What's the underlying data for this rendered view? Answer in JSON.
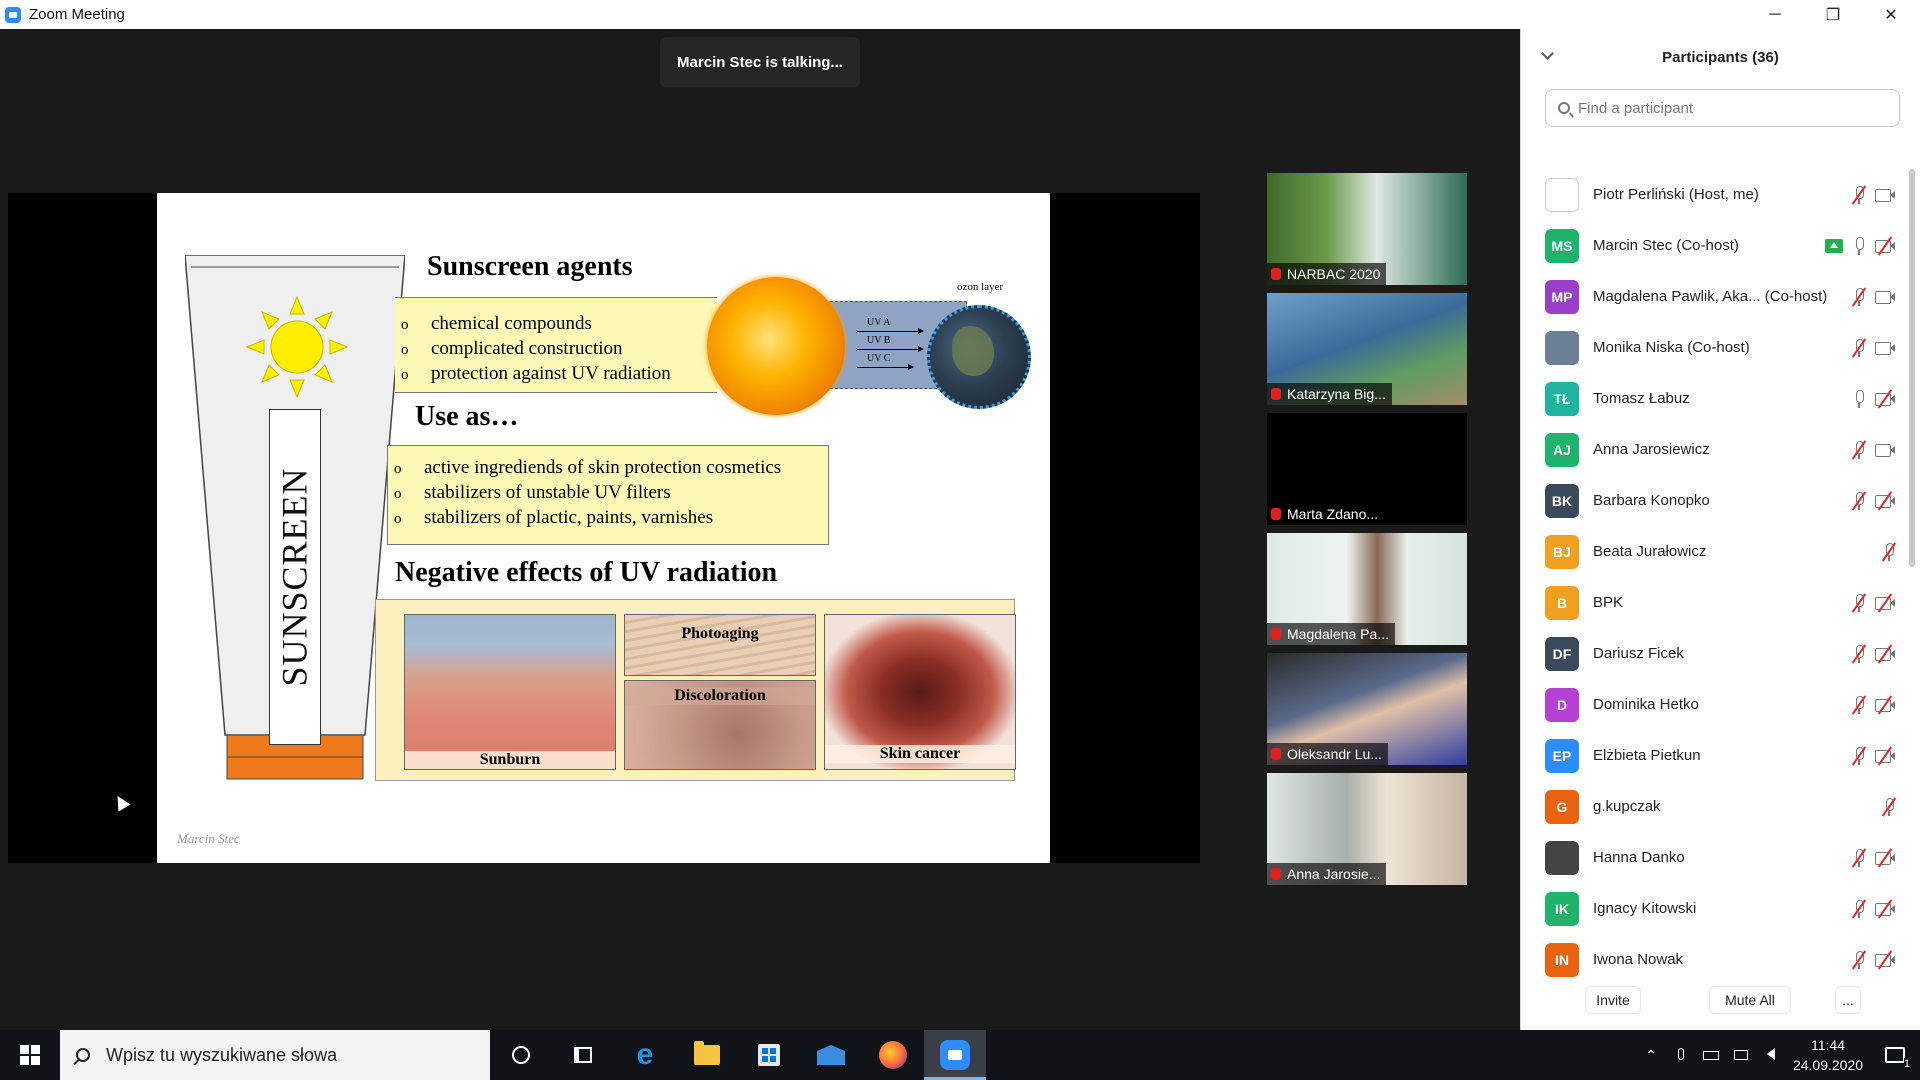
{
  "window": {
    "title": "Zoom Meeting",
    "minimize_glyph": "─",
    "restore_glyph": "❐",
    "close_glyph": "✕"
  },
  "meeting": {
    "talking_indicator": "Marcin Stec is talking..."
  },
  "slide": {
    "tube_label": "SUNSCREEN",
    "heading_agents": "Sunscreen agents",
    "agents_items": [
      "chemical compounds",
      "complicated construction",
      "protection against UV radiation"
    ],
    "ozone_label": "ozon layer",
    "uv_labels": [
      "UV A",
      "UV B",
      "UV C"
    ],
    "heading_use": "Use as…",
    "use_items": [
      "active ingrediends of skin protection cosmetics",
      "stabilizers of unstable UV filters",
      "stabilizers of plactic, paints, varnishes"
    ],
    "heading_negative": "Negative effects of UV radiation",
    "images": {
      "sunburn": "Sunburn",
      "photoaging": "Photoaging",
      "discoloration": "Discoloration",
      "skin_cancer": "Skin cancer"
    },
    "signature": "Marcin Stec"
  },
  "thumbnails": [
    {
      "name": "NARBAC 2020"
    },
    {
      "name": "Katarzyna Big..."
    },
    {
      "name": "Marta Zdano..."
    },
    {
      "name": "Magdalena Pa..."
    },
    {
      "name": "Oleksandr Lu..."
    },
    {
      "name": "Anna Jarosie..."
    }
  ],
  "participants_panel": {
    "title": "Participants (36)",
    "search_placeholder": "Find a participant",
    "participants": [
      {
        "initials": "",
        "name": "Piotr Perliński (Host, me)",
        "color": "#ffffff",
        "mic": "muted",
        "cam": "on"
      },
      {
        "initials": "MS",
        "name": "Marcin Stec (Co-host)",
        "color": "#1fb36b",
        "mic": "on",
        "cam": "off",
        "sharing": true
      },
      {
        "initials": "MP",
        "name": "Magdalena Pawlik, Aka...  (Co-host)",
        "color": "#9b3fc9",
        "mic": "muted",
        "cam": "on"
      },
      {
        "initials": "",
        "name": "Monika Niska (Co-host)",
        "color": "#6b7f95",
        "mic": "muted",
        "cam": "on"
      },
      {
        "initials": "TŁ",
        "name": "Tomasz Łabuz",
        "color": "#1fb3a0",
        "mic": "on",
        "cam": "off"
      },
      {
        "initials": "AJ",
        "name": "Anna Jarosiewicz",
        "color": "#1fb36b",
        "mic": "muted",
        "cam": "on"
      },
      {
        "initials": "BK",
        "name": "Barbara Konopko",
        "color": "#3a4a5c",
        "mic": "muted",
        "cam": "off"
      },
      {
        "initials": "BJ",
        "name": "Beata Jurałowicz",
        "color": "#f0a020",
        "mic": "muted",
        "cam": "none"
      },
      {
        "initials": "B",
        "name": "BPK",
        "color": "#f0a020",
        "mic": "muted",
        "cam": "off"
      },
      {
        "initials": "DF",
        "name": "Dariusz Ficek",
        "color": "#3a4a5c",
        "mic": "muted",
        "cam": "off"
      },
      {
        "initials": "D",
        "name": "Dominika Hetko",
        "color": "#b540d6",
        "mic": "muted",
        "cam": "off"
      },
      {
        "initials": "EP",
        "name": "Elżbieta Pietkun",
        "color": "#2d8cff",
        "mic": "muted",
        "cam": "off"
      },
      {
        "initials": "G",
        "name": "g.kupczak",
        "color": "#e8620f",
        "mic": "muted",
        "cam": "none"
      },
      {
        "initials": "",
        "name": "Hanna Danko",
        "color": "#444444",
        "mic": "muted",
        "cam": "off"
      },
      {
        "initials": "IK",
        "name": "Ignacy Kitowski",
        "color": "#1fb36b",
        "mic": "muted",
        "cam": "off"
      },
      {
        "initials": "IN",
        "name": "Iwona Nowak",
        "color": "#e8620f",
        "mic": "muted",
        "cam": "off"
      }
    ],
    "footer": {
      "invite": "Invite",
      "mute_all": "Mute All",
      "more": "..."
    }
  },
  "taskbar": {
    "search_placeholder": "Wpisz tu wyszukiwane słowa",
    "edge_glyph": "e",
    "time": "11:44",
    "date": "24.09.2020",
    "notification_count": "1",
    "chevron_glyph": "⌃"
  }
}
